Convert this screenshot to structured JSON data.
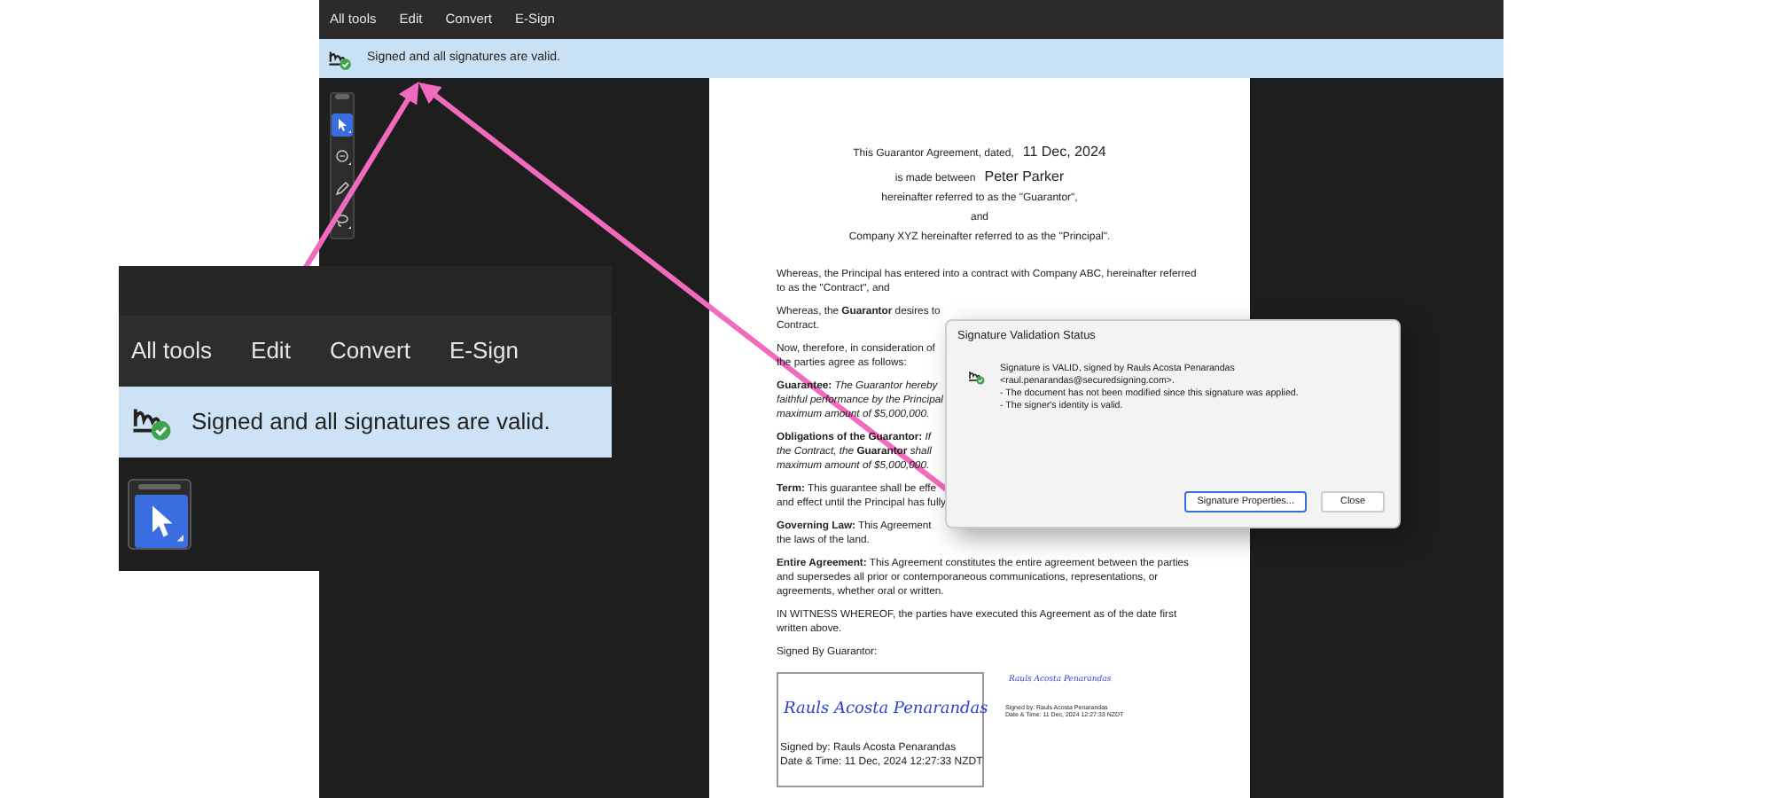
{
  "main": {
    "menu": [
      {
        "label": "All tools"
      },
      {
        "label": "Edit"
      },
      {
        "label": "Convert"
      },
      {
        "label": "E-Sign"
      }
    ],
    "banner": "Signed and all signatures are valid.",
    "tools": [
      {
        "kind": "select",
        "selected": true
      },
      {
        "kind": "comment",
        "selected": false
      },
      {
        "kind": "pen",
        "selected": false
      },
      {
        "kind": "lasso",
        "selected": false
      }
    ],
    "document": {
      "header": [
        {
          "text": "This Guarantor Agreement, dated,",
          "value": "11 Dec, 2024"
        },
        {
          "text": "is made between",
          "value": "Peter Parker"
        },
        {
          "text": "hereinafter referred to as the \"Guarantor\","
        },
        {
          "text": "and"
        },
        {
          "text": "Company XYZ hereinafter referred to as the \"Principal\"."
        }
      ],
      "paragraphs": [
        [
          "Whereas, the Principal has entered into a contract with Company ABC, hereinafter referred",
          "to as the \"Contract\", and"
        ],
        [
          "Whereas, the **Guarantor** desires to",
          "Contract."
        ],
        [
          "Now, therefore, in consideration of",
          "the parties agree as follows:"
        ],
        [
          "**Guarantee:** *The Guarantor hereby*",
          "*faithful performance by the Principal*",
          "*maximum amount of $5,000,000.*"
        ],
        [
          "**Obligations of the Guarantor:** *If*",
          "*the Contract, the* **Guarantor** *shall*",
          "*maximum amount of $5,000,000.*"
        ],
        [
          "**Term:** This guarantee shall be effe",
          "and effect until the Principal has fully"
        ],
        [
          "**Governing Law:** This Agreement",
          "the laws of the land."
        ],
        [
          "**Entire Agreement:** This Agreement constitutes the entire agreement between the parties",
          "and supersedes all prior or contemporaneous communications, representations, or",
          "agreements, whether oral or written."
        ],
        [
          "IN WITNESS WHEREOF, the parties have executed this Agreement as of the date first",
          "written above."
        ],
        [
          "Signed By Guarantor:"
        ]
      ],
      "signature_box": {
        "script": "Rauls Acosta Penarandas",
        "signed_by": "Signed by: Rauls Acosta Penarandas",
        "date_time": "Date & Time: 11 Dec, 2024 12:27:33 NZDT"
      },
      "signature_small": {
        "script": "Rauls Acosta Penarandas",
        "signed_by": "Signed by: Rauls Acosta Penarandas",
        "date_time": "Date & Time: 11 Dec, 2024 12:27:33 NZDT"
      }
    },
    "dialog": {
      "title": "Signature Validation Status",
      "lines": [
        "Signature is VALID, signed by Rauls Acosta Penarandas",
        "<raul.penarandas@securedsigning.com>.",
        "- The document has not been modified since this signature was applied.",
        "- The signer's identity is valid."
      ],
      "buttons": [
        {
          "label": "Signature Properties...",
          "selected": true
        },
        {
          "label": "Close",
          "selected": false
        }
      ]
    }
  },
  "zoom_inset": {
    "menu": [
      {
        "label": "All tools"
      },
      {
        "label": "Edit"
      },
      {
        "label": "Convert"
      },
      {
        "label": "E-Sign"
      }
    ],
    "banner": "Signed and all signatures are valid.",
    "tools": [
      {
        "kind": "select",
        "selected": true
      }
    ]
  }
}
